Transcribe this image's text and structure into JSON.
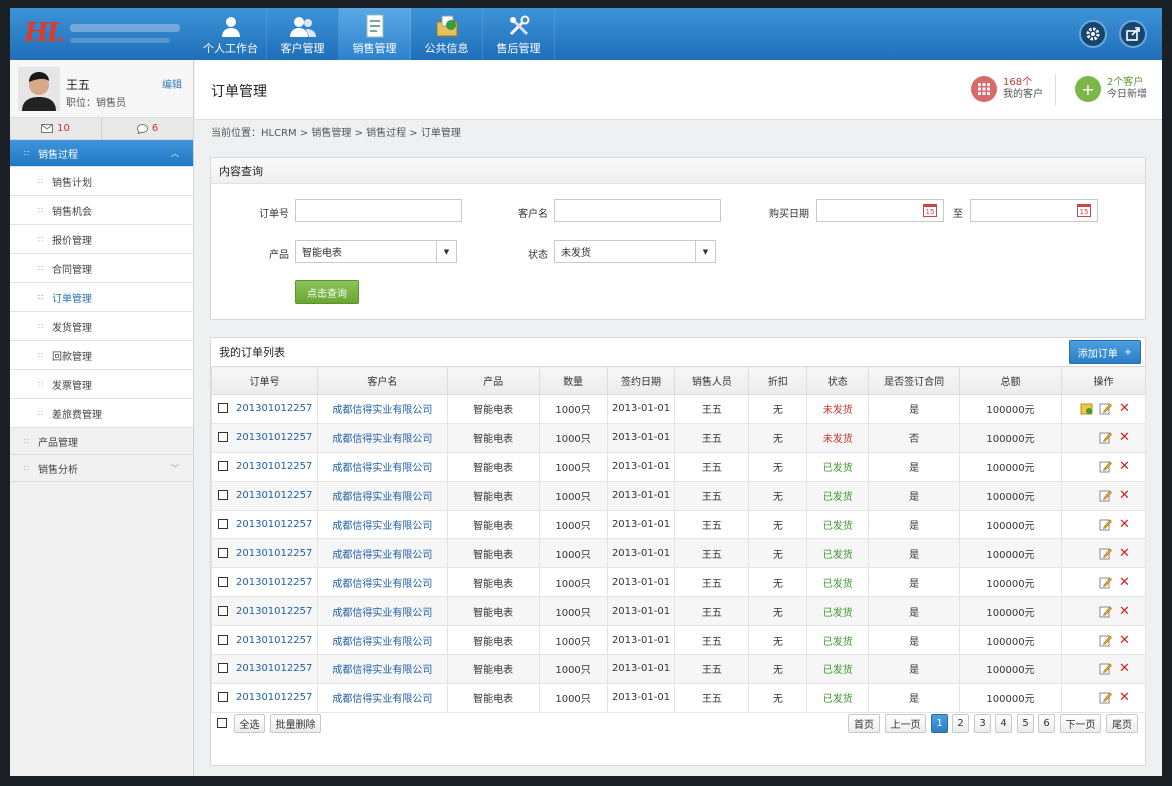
{
  "nav": [
    "个人工作台",
    "客户管理",
    "销售管理",
    "公共信息",
    "售后管理"
  ],
  "logo": {
    "mark": "HL"
  },
  "user": {
    "name": "王五",
    "role": "职位：销售员",
    "edit": "编辑",
    "mail_count": "10",
    "msg_count": "6"
  },
  "menu": {
    "group1": "销售过程",
    "items": [
      "销售计划",
      "销售机会",
      "报价管理",
      "合同管理",
      "订单管理",
      "发货管理",
      "回款管理",
      "发票管理",
      "差旅费管理"
    ],
    "group2": "产品管理",
    "group3": "销售分析"
  },
  "header": {
    "title": "订单管理",
    "stat1_num": "168个",
    "stat1_label": "我的客户",
    "stat2_num": "2个客户",
    "stat2_label": "今日新增"
  },
  "breadcrumb": "当前位置：HLCRM > 销售管理 > 销售过程 > 订单管理",
  "search": {
    "title": "内容查询",
    "order_label": "订单号",
    "customer_label": "客户名",
    "date_label": "购买日期",
    "to_label": "至",
    "product_label": "产品",
    "product_value": "智能电表",
    "status_label": "状态",
    "status_value": "未发货",
    "submit": "点击查询",
    "cal_day": "15"
  },
  "orders": {
    "title": "我的订单列表",
    "add_label": "添加订单",
    "columns": [
      "订单号",
      "客户名",
      "产品",
      "数量",
      "签约日期",
      "销售人员",
      "折扣",
      "状态",
      "是否签订合同",
      "总额",
      "操作"
    ],
    "rows": [
      [
        "201301012257",
        "成都信得实业有限公司",
        "智能电表",
        "1000只",
        "2013-01-01",
        "王五",
        "无",
        "未发货",
        "是",
        "100000元"
      ],
      [
        "201301012257",
        "成都信得实业有限公司",
        "智能电表",
        "1000只",
        "2013-01-01",
        "王五",
        "无",
        "未发货",
        "否",
        "100000元"
      ],
      [
        "201301012257",
        "成都信得实业有限公司",
        "智能电表",
        "1000只",
        "2013-01-01",
        "王五",
        "无",
        "已发货",
        "是",
        "100000元"
      ],
      [
        "201301012257",
        "成都信得实业有限公司",
        "智能电表",
        "1000只",
        "2013-01-01",
        "王五",
        "无",
        "已发货",
        "是",
        "100000元"
      ],
      [
        "201301012257",
        "成都信得实业有限公司",
        "智能电表",
        "1000只",
        "2013-01-01",
        "王五",
        "无",
        "已发货",
        "是",
        "100000元"
      ],
      [
        "201301012257",
        "成都信得实业有限公司",
        "智能电表",
        "1000只",
        "2013-01-01",
        "王五",
        "无",
        "已发货",
        "是",
        "100000元"
      ],
      [
        "201301012257",
        "成都信得实业有限公司",
        "智能电表",
        "1000只",
        "2013-01-01",
        "王五",
        "无",
        "已发货",
        "是",
        "100000元"
      ],
      [
        "201301012257",
        "成都信得实业有限公司",
        "智能电表",
        "1000只",
        "2013-01-01",
        "王五",
        "无",
        "已发货",
        "是",
        "100000元"
      ],
      [
        "201301012257",
        "成都信得实业有限公司",
        "智能电表",
        "1000只",
        "2013-01-01",
        "王五",
        "无",
        "已发货",
        "是",
        "100000元"
      ],
      [
        "201301012257",
        "成都信得实业有限公司",
        "智能电表",
        "1000只",
        "2013-01-01",
        "王五",
        "无",
        "已发货",
        "是",
        "100000元"
      ],
      [
        "201301012257",
        "成都信得实业有限公司",
        "智能电表",
        "1000只",
        "2013-01-01",
        "王五",
        "无",
        "已发货",
        "是",
        "100000元"
      ]
    ],
    "select_all": "全选",
    "batch_delete": "批量删除"
  },
  "pager": {
    "first": "首页",
    "prev": "上一页",
    "pages": [
      "1",
      "2",
      "3",
      "4",
      "5",
      "6"
    ],
    "current": "1",
    "next": "下一页",
    "last": "尾页"
  },
  "colors": {
    "accent": "#2a7ec6",
    "unsent": "#c0392b",
    "sent": "#3c9a2c",
    "green_button": "#6aa636"
  }
}
